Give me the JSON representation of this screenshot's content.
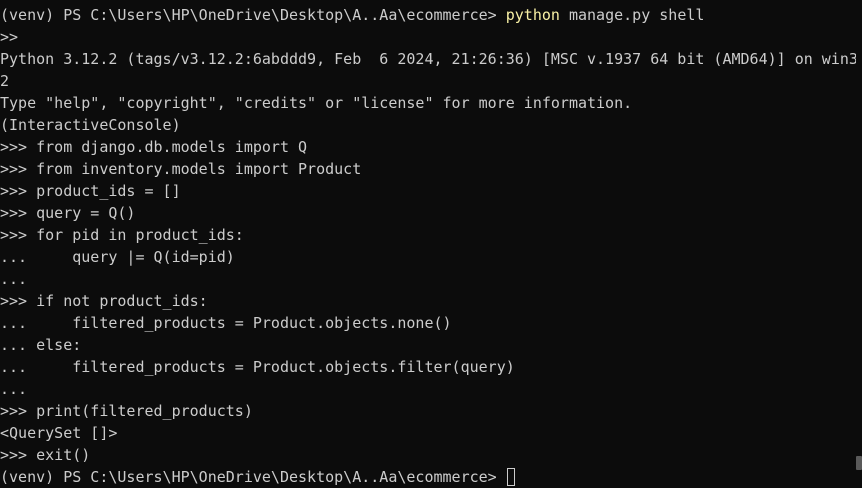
{
  "terminal": {
    "lines": [
      {
        "prompt": "(venv) PS C:\\Users\\HP\\OneDrive\\Desktop\\A..Aa\\ecommerce> ",
        "cmd": "python",
        "rest": " manage.py shell"
      },
      {
        "text": ">>"
      },
      {
        "text": "Python 3.12.2 (tags/v3.12.2:6abddd9, Feb  6 2024, 21:26:36) [MSC v.1937 64 bit (AMD64)] on win3"
      },
      {
        "text": "2"
      },
      {
        "text": "Type \"help\", \"copyright\", \"credits\" or \"license\" for more information."
      },
      {
        "text": "(InteractiveConsole)"
      },
      {
        "text": ">>> from django.db.models import Q"
      },
      {
        "text": ">>> from inventory.models import Product"
      },
      {
        "text": ">>> product_ids = []"
      },
      {
        "text": ">>> query = Q()"
      },
      {
        "text": ">>> for pid in product_ids:"
      },
      {
        "text": "...     query |= Q(id=pid)"
      },
      {
        "text": "..."
      },
      {
        "text": ">>> if not product_ids:"
      },
      {
        "text": "...     filtered_products = Product.objects.none()"
      },
      {
        "text": "... else:"
      },
      {
        "text": "...     filtered_products = Product.objects.filter(query)"
      },
      {
        "text": "..."
      },
      {
        "text": ">>> print(filtered_products)"
      },
      {
        "text": "<QuerySet []>"
      },
      {
        "text": ">>> exit()"
      }
    ],
    "final_prompt": "(venv) PS C:\\Users\\HP\\OneDrive\\Desktop\\A..Aa\\ecommerce> "
  },
  "colors": {
    "background": "#0c0c0c",
    "foreground": "#cccccc",
    "command_highlight": "#f9f1a5"
  }
}
